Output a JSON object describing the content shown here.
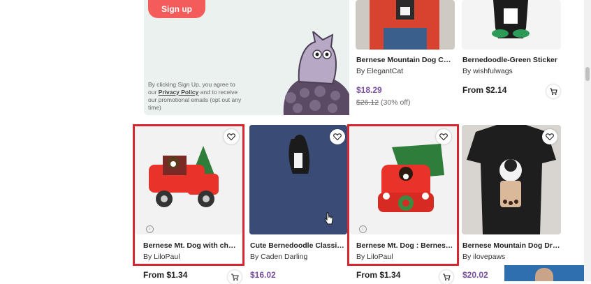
{
  "promo": {
    "signup_label": "Sign up",
    "legal_prefix": "By clicking Sign Up, you agree to our ",
    "legal_link": "Privacy Policy",
    "legal_suffix": " and to receive our promotional emails (opt out any time)"
  },
  "products": [
    {
      "title": "Bernese Mountain Dog Cute ...",
      "artist": "By ElegantCat",
      "price": "$18.29",
      "original_price": "$26.12",
      "discount": "(30% off)"
    },
    {
      "title": "Bernedoodle-Green Sticker",
      "artist": "By wishfulwags",
      "price": "From $2.14"
    },
    {
      "title": "Bernese Mt. Dog with charis...",
      "artist": "By LiloPaul",
      "price": "From $1.34"
    },
    {
      "title": "Cute Bernedoodle Classic T-...",
      "artist": "By Caden Darling",
      "price": "$16.02"
    },
    {
      "title": "Bernese Mt. Dog : Bernese M...",
      "artist": "By LiloPaul",
      "price": "From $1.34"
    },
    {
      "title": "Bernese Mountain Dog Drinki...",
      "artist": "By ilovepaws",
      "price": "$20.02"
    }
  ],
  "colors": {
    "accent": "#f45b5b",
    "sale": "#7a4fa0",
    "highlight": "#d7262f"
  }
}
